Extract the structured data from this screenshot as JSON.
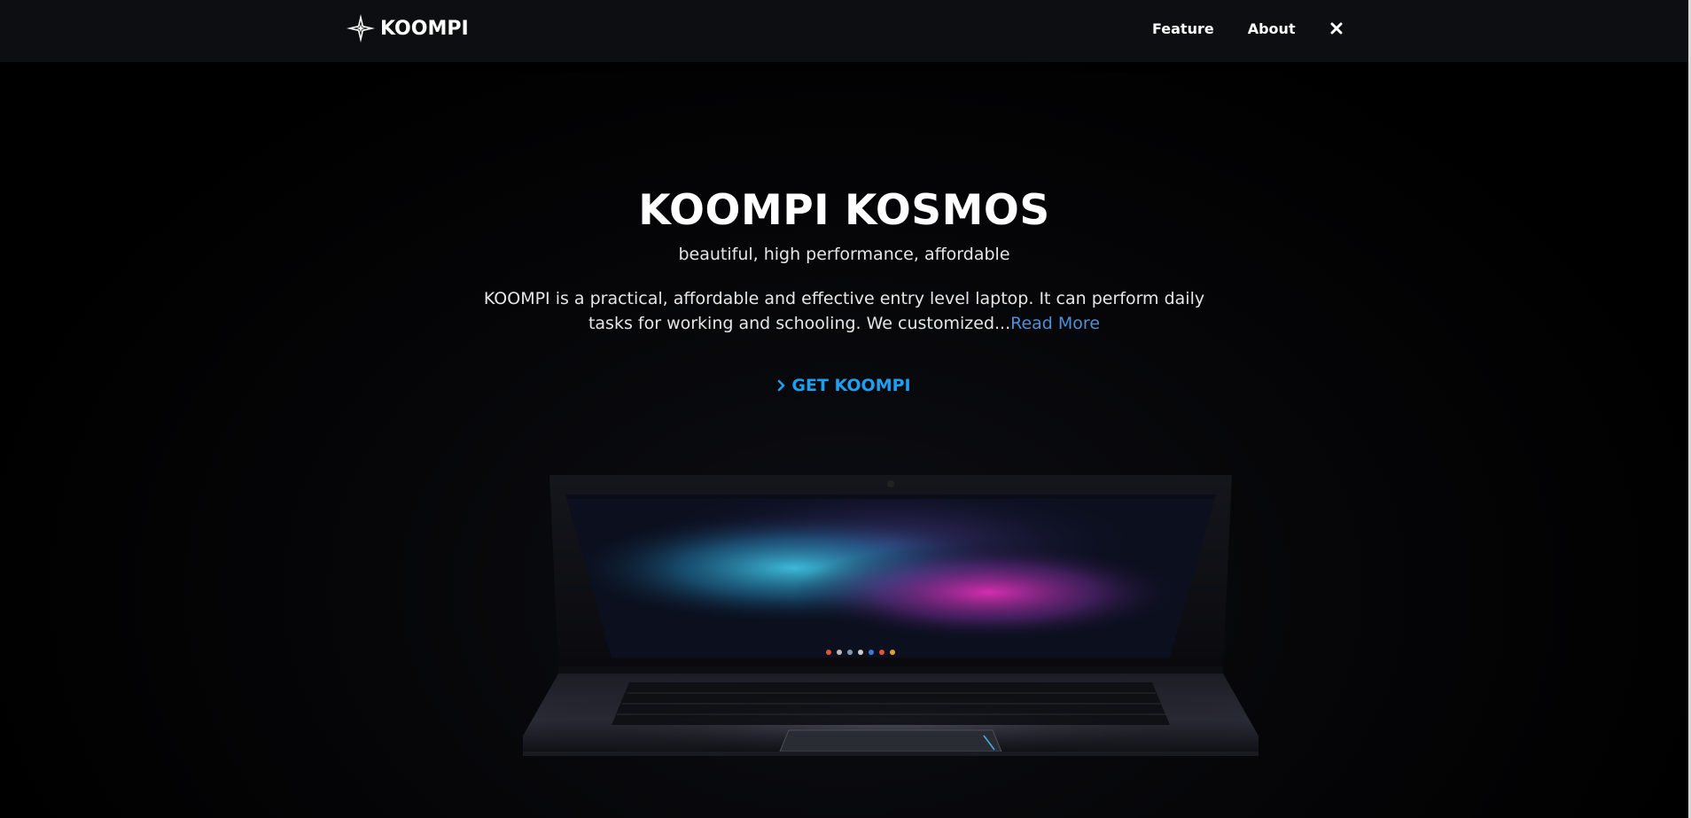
{
  "nav": {
    "brand_name": "KOOMPI",
    "links": [
      {
        "label": "Feature"
      },
      {
        "label": "About"
      }
    ],
    "close_icon": "close-icon"
  },
  "hero": {
    "title": "KOOMPI KOSMOS",
    "tagline": "beautiful, high performance, affordable",
    "description": "KOOMPI is a practical, affordable and effective entry level laptop. It can perform daily tasks for working and schooling. We customized...",
    "read_more": "Read More",
    "cta_label": "GET KOOMPI",
    "cta_icon": "chevron-right-icon"
  },
  "colors": {
    "background": "#000000",
    "navbar": "#0d0e11",
    "text": "#ffffff",
    "link": "#4f8fd6",
    "cta": "#1e9ff0"
  }
}
